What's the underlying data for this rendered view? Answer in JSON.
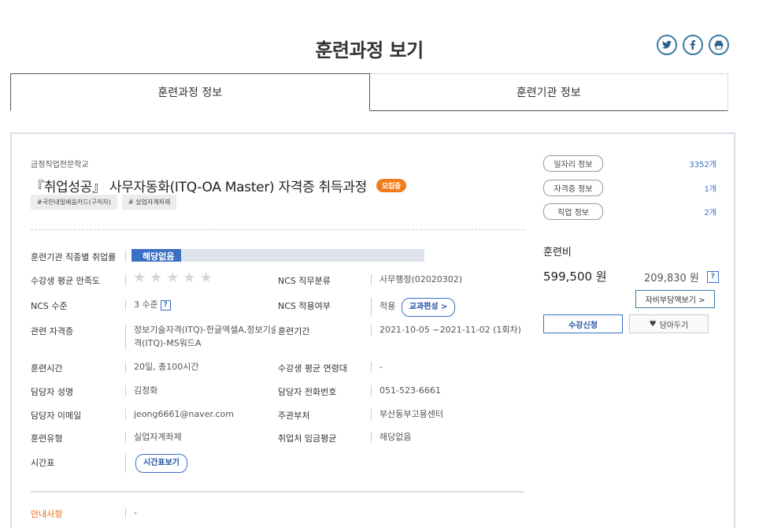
{
  "header": {
    "title": "훈련과정 보기"
  },
  "tabs": [
    {
      "label": "훈련과정 정보"
    },
    {
      "label": "훈련기관 정보"
    }
  ],
  "course": {
    "school": "금정직업전문학교",
    "title": "『취업성공』 사무자동화(ITQ-OA Master) 자격증 취득과정",
    "status_badge": "모집중",
    "tags": [
      "#국민내일배움카드(구직자)",
      "# 실업자계좌제"
    ]
  },
  "details": {
    "employment_rate_label": "훈련기관 직종별 취업률",
    "employment_rate_value": "해당없음",
    "employment_rate_fill": 0.17,
    "satisfaction_label": "수강생 평균 만족도",
    "satisfaction_stars": 0,
    "ncs_category_label": "NCS 직무분류",
    "ncs_category_value": "사무행정(02020302)",
    "ncs_level_label": "NCS 수준",
    "ncs_level_value": "3 수준",
    "ncs_apply_label": "NCS 적용여부",
    "ncs_apply_value": "적용",
    "curriculum_button": "교과편성 >",
    "cert_label": "관련 자격증",
    "cert_value_1": "정보기술자격(ITQ)-한글엑셀A,정보기술자",
    "cert_value_2": "격(ITQ)-MS워드A",
    "period_label": "훈련기간",
    "period_value": "2021-10-05 ~2021-11-02 (1회차)",
    "hours_label": "훈련시간",
    "hours_value": "20일, 총100시간",
    "avg_age_label": "수강생 평균 연령대",
    "avg_age_value": "-",
    "manager_label": "담당자 성명",
    "manager_value": "김정화",
    "phone_label": "담당자 전화번호",
    "phone_value": "051-523-6661",
    "email_label": "담당자 이메일",
    "email_value": "jeong6661@naver.com",
    "agency_label": "주관부처",
    "agency_value": "부산동부고용센터",
    "type_label": "훈련유형",
    "type_value": "실업자계좌제",
    "wage_label": "취업처 임금평균",
    "wage_value": "해당없음",
    "schedule_label": "시간표",
    "schedule_button": "시간표보기",
    "notice_label": "안내사항",
    "notice_value": "-"
  },
  "side": {
    "jobs_label": "일자리 정보",
    "jobs_count": "3352개",
    "certs_label": "자격증 정보",
    "certs_count": "1개",
    "occupation_label": "직업 정보",
    "occupation_count": "2개",
    "fee_label": "훈련비",
    "fee_total": "599,500 원",
    "fee_self": "209,830 원",
    "self_pay_button": "자비부담액보기 >",
    "apply_button": "수강신청",
    "save_button": "담아두기"
  },
  "colors": {
    "accent_blue": "#3a6fc4",
    "badge_orange": "#f07c1e",
    "notice_orange": "#e86b1c"
  }
}
